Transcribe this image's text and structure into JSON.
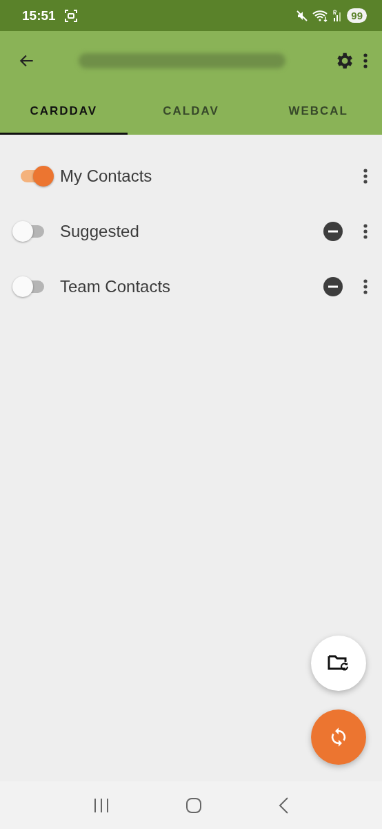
{
  "status_bar": {
    "time": "15:51",
    "battery": "99"
  },
  "tabs": [
    {
      "label": "CARDDAV",
      "selected": true
    },
    {
      "label": "CALDAV",
      "selected": false
    },
    {
      "label": "WEBCAL",
      "selected": false
    }
  ],
  "collections": [
    {
      "name": "My Contacts",
      "on": true,
      "removable": false
    },
    {
      "name": "Suggested",
      "on": false,
      "removable": true
    },
    {
      "name": "Team Contacts",
      "on": false,
      "removable": true
    }
  ]
}
